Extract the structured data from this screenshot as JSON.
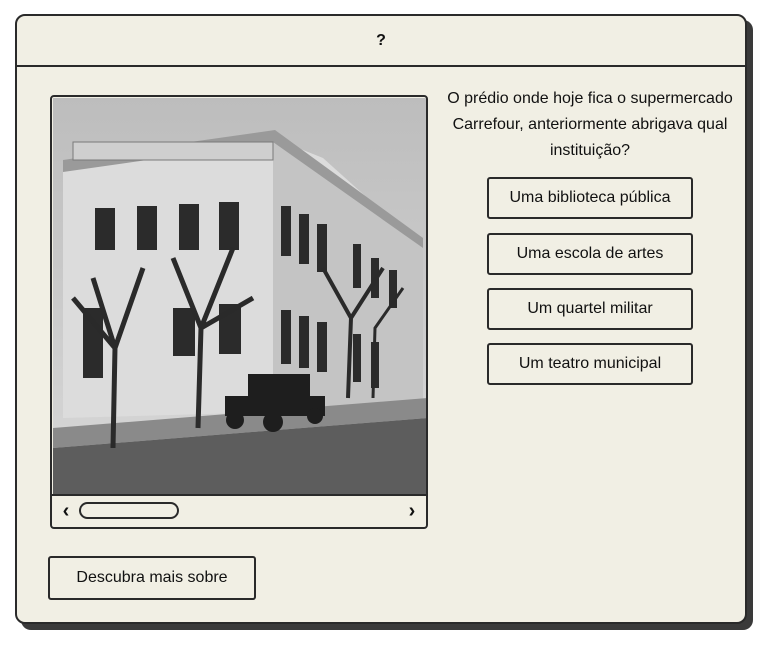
{
  "window": {
    "title": "?"
  },
  "image": {
    "description_icon": "historic-building-photo"
  },
  "scrollbar": {
    "left_arrow": "‹",
    "right_arrow": "›"
  },
  "quiz": {
    "question": "O prédio onde hoje fica o supermercado Carrefour, anteriormente abrigava qual instituição?",
    "answers": [
      "Uma biblioteca pública",
      "Uma escola de artes",
      "Um quartel militar",
      "Um teatro municipal"
    ]
  },
  "footer": {
    "more_button": "Descubra mais sobre"
  },
  "colors": {
    "panel": "#f1efe4",
    "border": "#2a2a2a"
  }
}
